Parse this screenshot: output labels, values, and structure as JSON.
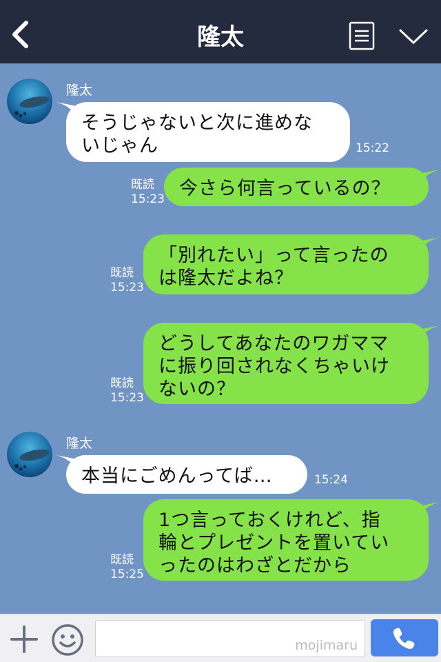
{
  "header": {
    "title": "隆太",
    "back_icon": "chevron-left-icon",
    "menu_icon": "notes-icon",
    "more_icon": "chevron-down-icon",
    "background": "#242b3f"
  },
  "chat": {
    "background": "#7094c4",
    "incoming_bubble_color": "#ffffff",
    "outgoing_bubble_color": "#85e249",
    "messages": [
      {
        "direction": "in",
        "sender": "隆太",
        "lines": [
          "そうじゃないと次に進めな",
          "いじゃん"
        ],
        "time": "15:22"
      },
      {
        "direction": "out",
        "read": "既読",
        "lines": [
          "今さら何言っているの？"
        ],
        "time": "15:23"
      },
      {
        "direction": "out",
        "read": "既読",
        "lines": [
          "「別れたい」って言ったの",
          "は隆太だよね？"
        ],
        "time": "15:23"
      },
      {
        "direction": "out",
        "read": "既読",
        "lines": [
          "どうしてあなたのワガママ",
          "に振り回されなくちゃいけ",
          "ないの？"
        ],
        "time": "15:23"
      },
      {
        "direction": "in",
        "sender": "隆太",
        "lines": [
          "本当にごめんってば…"
        ],
        "time": "15:24"
      },
      {
        "direction": "out",
        "read": "既読",
        "lines": [
          "1つ言っておくけれど、指",
          "輪とプレゼントを置いてい",
          "ったのはわざとだから"
        ],
        "time": "15:25"
      }
    ]
  },
  "bottombar": {
    "plus_icon": "plus-icon",
    "sticker_icon": "smiley-icon",
    "input_value": "",
    "watermark": "mojimaru",
    "call_icon": "phone-icon",
    "call_color": "#4a84e8"
  }
}
